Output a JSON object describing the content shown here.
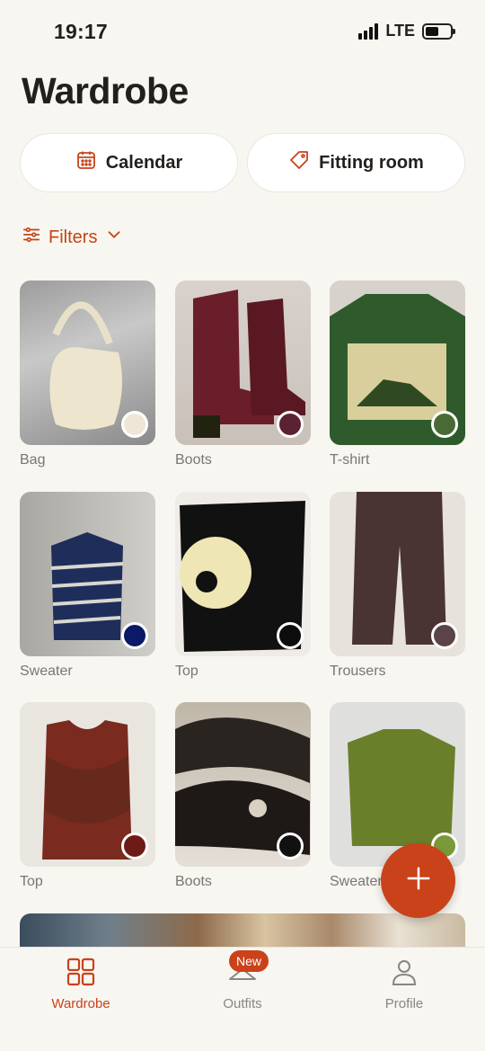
{
  "status_bar": {
    "time": "19:17",
    "network": "LTE"
  },
  "page": {
    "title": "Wardrobe"
  },
  "actions": {
    "calendar": "Calendar",
    "fitting_room": "Fitting room"
  },
  "filters": {
    "label": "Filters"
  },
  "items": [
    {
      "label": "Bag",
      "color": "#efe6d8"
    },
    {
      "label": "Boots",
      "color": "#5a2233"
    },
    {
      "label": "T-shirt",
      "color": "#4a6a35"
    },
    {
      "label": "Sweater",
      "color": "#0a1a66"
    },
    {
      "label": "Top",
      "color": "#0d0d0d"
    },
    {
      "label": "Trousers",
      "color": "#5a4448"
    },
    {
      "label": "Top",
      "color": "#6e1b17"
    },
    {
      "label": "Boots",
      "color": "#111111"
    },
    {
      "label": "Sweater",
      "color": "#7a9a3a"
    }
  ],
  "tabs": {
    "wardrobe": "Wardrobe",
    "outfits": "Outfits",
    "outfits_badge": "New",
    "profile": "Profile"
  },
  "colors": {
    "accent": "#c9421a",
    "background": "#f8f6f1"
  }
}
